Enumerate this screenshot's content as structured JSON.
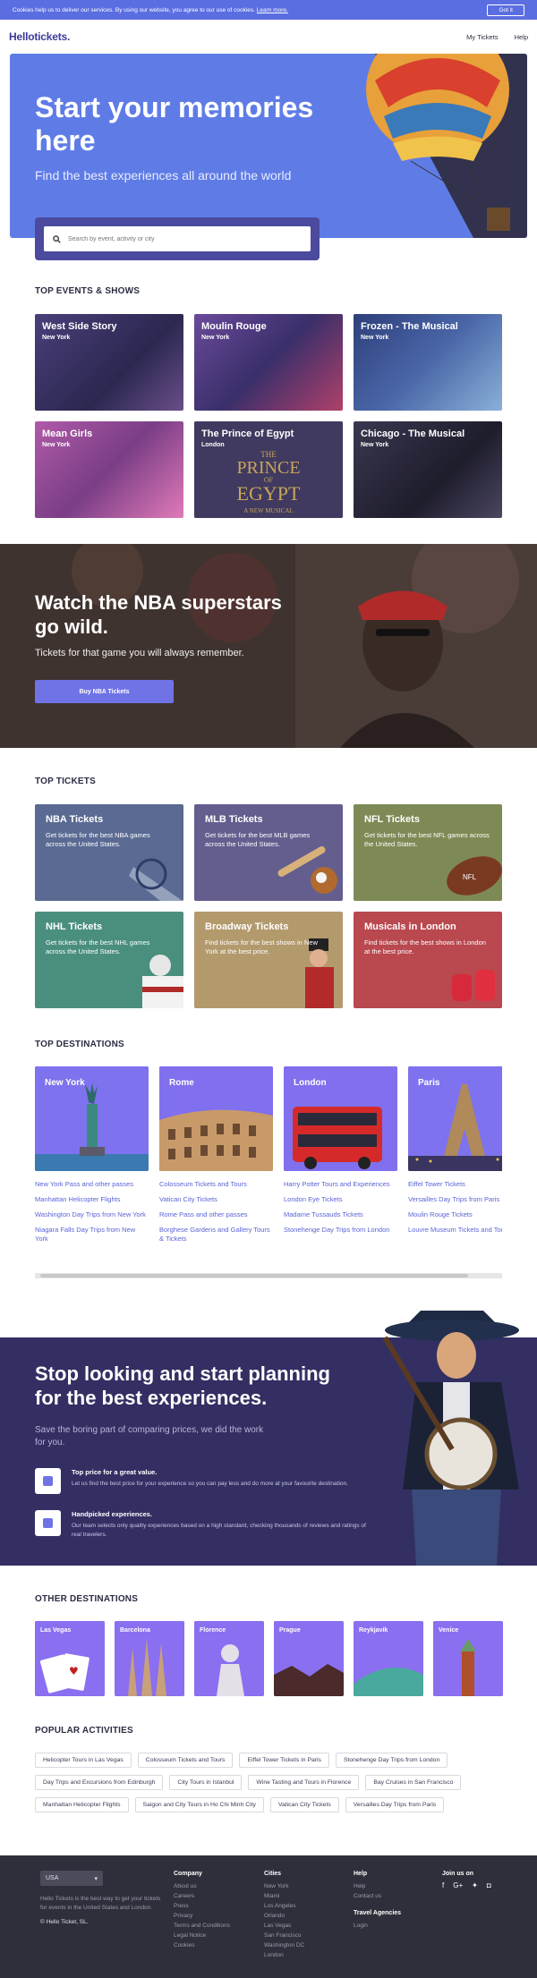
{
  "cookie": {
    "text": "Cookies help us to deliver our services. By using our website, you agree to our use of cookies.",
    "link": "Learn more.",
    "button": "Got it"
  },
  "nav": {
    "logo": "Hellotickets.",
    "my_tickets": "My Tickets",
    "help": "Help"
  },
  "hero": {
    "title": "Start your memories here",
    "subtitle": "Find the best experiences all around the world",
    "search_placeholder": "Search by event, activity or city"
  },
  "events": {
    "title": "TOP EVENTS & SHOWS",
    "items": [
      {
        "title": "West Side Story",
        "city": "New York",
        "color": "#3a3566"
      },
      {
        "title": "Moulin Rouge",
        "city": "New York",
        "color": "#4e3a7a"
      },
      {
        "title": "Frozen - The Musical",
        "city": "New York",
        "color": "#364a86"
      },
      {
        "title": "Mean Girls",
        "city": "New York",
        "color": "#8a4c95"
      },
      {
        "title": "The Prince of Egypt",
        "city": "London",
        "color": "#3b3458"
      },
      {
        "title": "Chicago - The Musical",
        "city": "New York",
        "color": "#2c2a3e"
      }
    ],
    "egypt_poster": [
      "THE",
      "PRINCE",
      "OF",
      "EGYPT",
      "A NEW MUSICAL"
    ]
  },
  "nba": {
    "title": "Watch the NBA superstars go wild.",
    "subtitle": "Tickets for that game you will always remember.",
    "button": "Buy NBA Tickets"
  },
  "top_tickets": {
    "title": "TOP TICKETS",
    "items": [
      {
        "title": "NBA Tickets",
        "desc": "Get tickets for the best NBA games across the United States.",
        "color": "#5a6a93"
      },
      {
        "title": "MLB Tickets",
        "desc": "Get tickets for the best MLB games across the United States.",
        "color": "#635e8e"
      },
      {
        "title": "NFL Tickets",
        "desc": "Get tickets for the best NFL games across the United States.",
        "color": "#7e8a55"
      },
      {
        "title": "NHL Tickets",
        "desc": "Get tickets for the best NHL games across the United States.",
        "color": "#4a8f7e"
      },
      {
        "title": "Broadway Tickets",
        "desc": "Find tickets for the best shows in New York at the best price.",
        "color": "#b39a6d"
      },
      {
        "title": "Musicals in London",
        "desc": "Find tickets for the best shows in London at the best price.",
        "color": "#b9484f"
      }
    ],
    "football_label": "NFL"
  },
  "destinations": {
    "title": "TOP DESTINATIONS",
    "items": [
      {
        "name": "New York",
        "links": [
          "New York Pass and other passes",
          "Manhattan Helicopter Flights",
          "Washington Day Trips from New York",
          "Niagara Falls Day Trips from New York"
        ]
      },
      {
        "name": "Rome",
        "links": [
          "Colosseum Tickets and Tours",
          "Vatican City Tickets",
          "Rome Pass and other passes",
          "Borghese Gardens and Gallery Tours & Tickets"
        ]
      },
      {
        "name": "London",
        "links": [
          "Harry Potter Tours and Experiences",
          "London Eye Tickets",
          "Madame Tussauds Tickets",
          "Stonehenge Day Trips from London"
        ]
      },
      {
        "name": "Paris",
        "links": [
          "Eiffel Tower Tickets",
          "Versailles Day Trips from Paris",
          "Moulin Rouge Tickets",
          "Louvre Museum Tickets and Tours"
        ]
      }
    ]
  },
  "plan": {
    "title": "Stop looking and start planning for the best experiences.",
    "subtitle": "Save the boring part of comparing prices, we did the work for you.",
    "features": [
      {
        "title": "Top price for a great value.",
        "desc": "Let us find the best price for your experience so you can pay less and do more at your favourite destination."
      },
      {
        "title": "Handpicked experiences.",
        "desc": "Our team selects only quality experiences based on a high standard, checking thousands of reviews and ratings of real travelers."
      }
    ]
  },
  "other_destinations": {
    "title": "OTHER DESTINATIONS",
    "items": [
      "Las Vegas",
      "Barcelona",
      "Florence",
      "Prague",
      "Reykjavik",
      "Venice"
    ]
  },
  "popular": {
    "title": "POPULAR ACTIVITIES",
    "items": [
      "Helicopter Tours in Las Vegas",
      "Colosseum Tickets and Tours",
      "Eiffel Tower Tickets in Paris",
      "Stonehenge Day Trips from London",
      "Day Trips and Excursions from Edinburgh",
      "City Tours in Istanbul",
      "Wine Tasting and Tours in Florence",
      "Bay Cruises in San Francisco",
      "Manhattan Helicopter Flights",
      "Saigon and City Tours in Ho Chi Minh City",
      "Vatican City Tickets",
      "Versailles Day Trips from Paris"
    ]
  },
  "footer": {
    "country": "USA",
    "about": "Hello Tickets is the best way to get your tickets for events in the United States and London.",
    "copyright": "© Hello Ticket, SL.",
    "company": {
      "title": "Company",
      "links": [
        "About us",
        "Careers",
        "Press",
        "Privacy",
        "Terms and Conditions",
        "Legal Notice",
        "Cookies"
      ]
    },
    "cities": {
      "title": "Cities",
      "links": [
        "New York",
        "Miami",
        "Los Angeles",
        "Orlando",
        "Las Vegas",
        "San Francisco",
        "Washington DC",
        "London"
      ]
    },
    "help": {
      "title": "Help",
      "links": [
        "Help",
        "Contact us"
      ]
    },
    "agencies": {
      "title": "Travel Agencies",
      "links": [
        "Login"
      ]
    },
    "join": {
      "title": "Join us on"
    }
  }
}
